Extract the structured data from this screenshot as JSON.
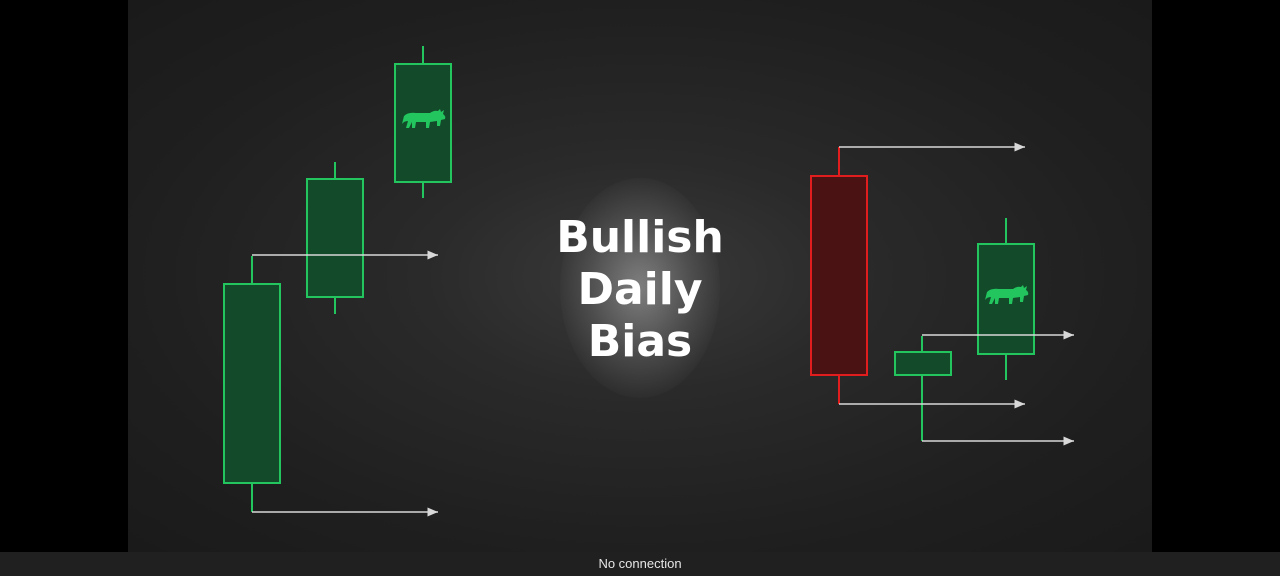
{
  "video": {
    "title_lines": [
      "Bullish",
      "Daily",
      "Bias"
    ]
  },
  "status": {
    "text": "No connection"
  },
  "colors": {
    "bull": "#22c55e",
    "bull_fill": "#124a2a",
    "bear": "#e11d1d",
    "bear_fill": "#4a1212",
    "arrow": "#d8d8d8"
  },
  "icons": {
    "bull_icon": "bull-icon"
  }
}
